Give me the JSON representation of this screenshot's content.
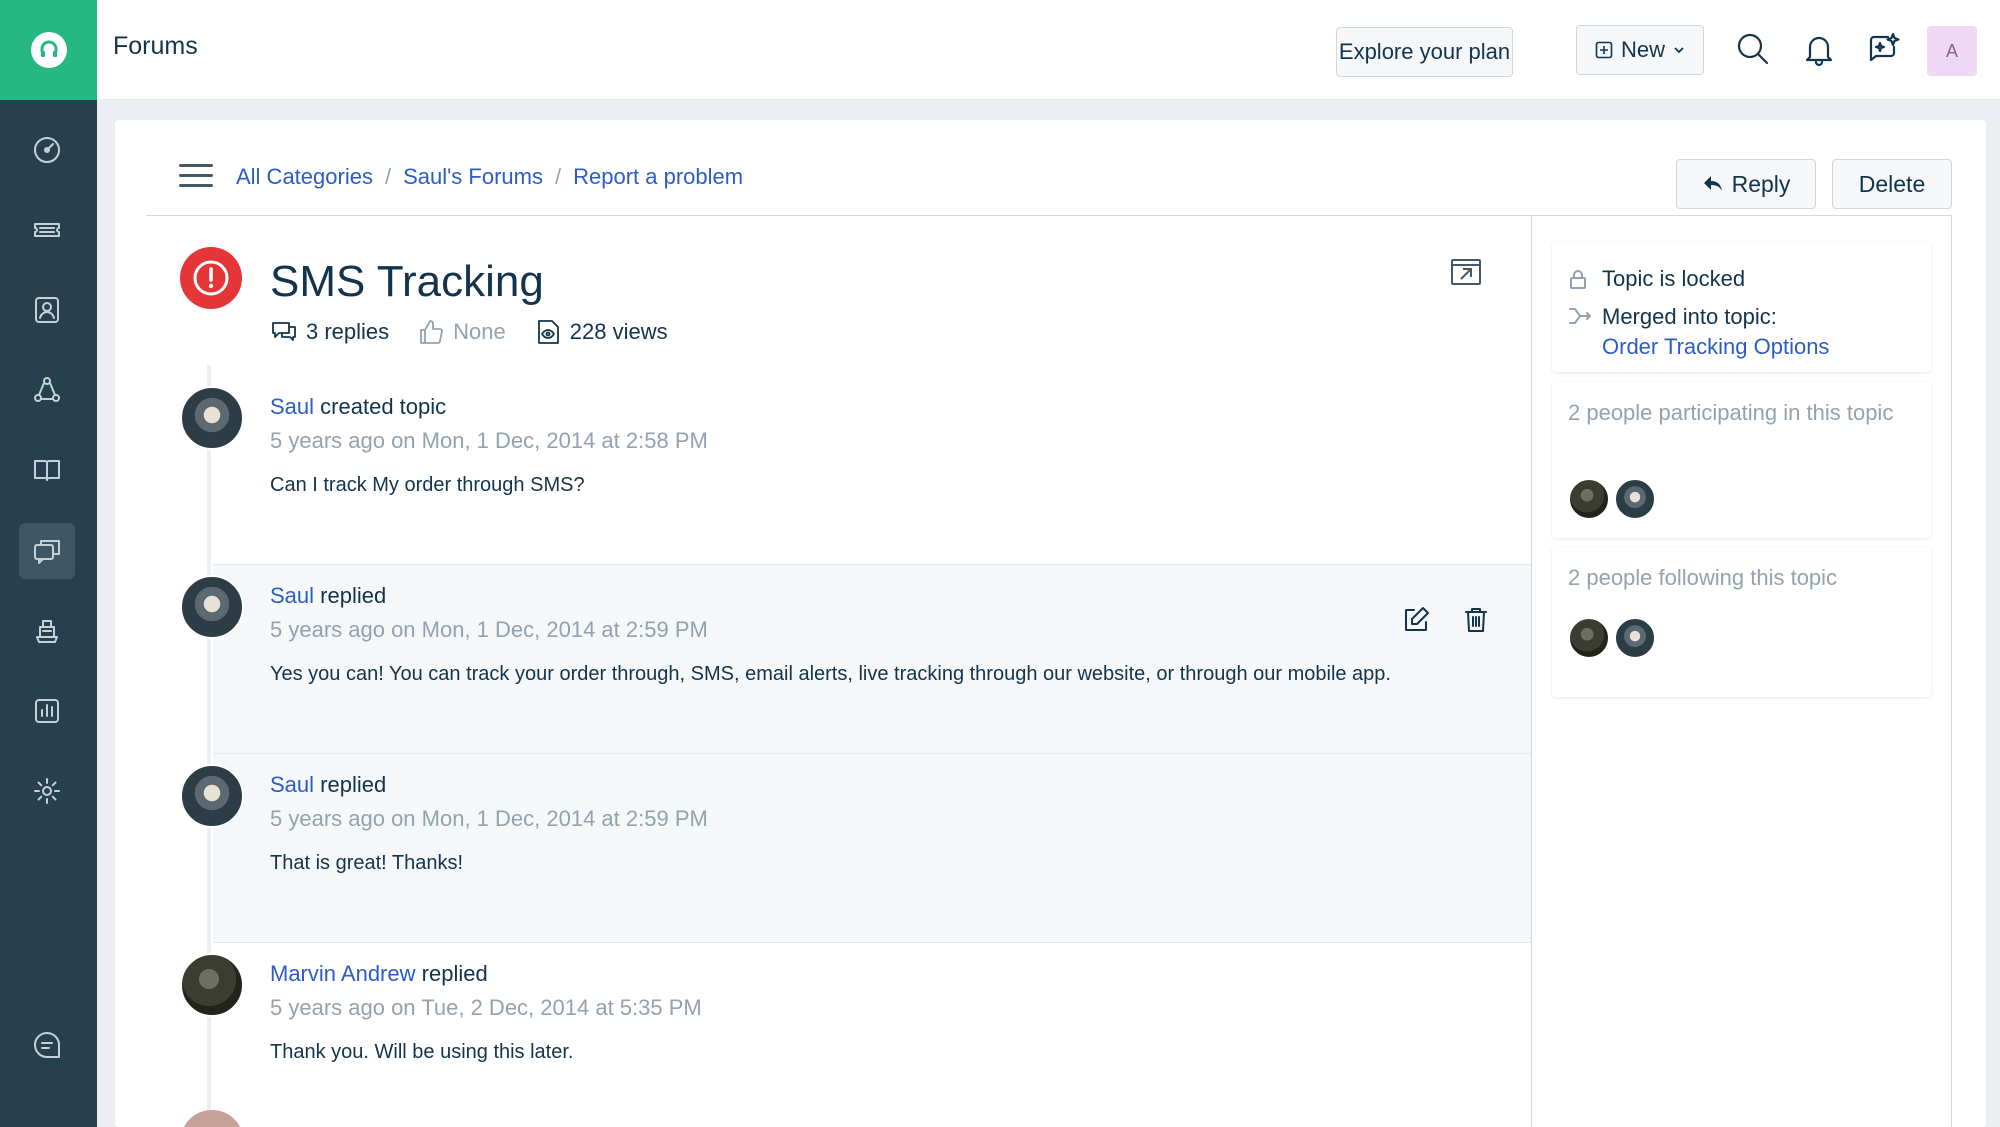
{
  "header": {
    "title": "Forums",
    "explore_label": "Explore your plan",
    "new_label": "New",
    "avatar_initial": "A"
  },
  "nav": {
    "icons": [
      "dashboard-icon",
      "tickets-icon",
      "contacts-icon",
      "groups-icon",
      "solutions-icon",
      "forums-icon",
      "ship-icon",
      "reports-icon",
      "settings-icon",
      "chat-icon"
    ],
    "active": "forums-icon"
  },
  "breadcrumb": {
    "items": [
      "All Categories",
      "Saul's Forums",
      "Report a problem"
    ],
    "separator": "/"
  },
  "actions": {
    "reply_label": "Reply",
    "delete_label": "Delete"
  },
  "topic": {
    "title": "SMS Tracking",
    "replies": "3 replies",
    "votes": "None",
    "views": "228 views"
  },
  "posts": [
    {
      "author": "Saul",
      "action": "created topic",
      "time": "5 years ago on Mon, 1 Dec, 2014 at 2:58 PM",
      "body": "Can I track My order through SMS?"
    },
    {
      "author": "Saul",
      "action": "replied",
      "time": "5 years ago on Mon, 1 Dec, 2014 at 2:59 PM",
      "body": "Yes you can! You can track your order through, SMS, email alerts, live tracking through our website, or through our mobile app."
    },
    {
      "author": "Saul",
      "action": "replied",
      "time": "5 years ago on Mon, 1 Dec, 2014 at 2:59 PM",
      "body": "That is great! Thanks!"
    },
    {
      "author": "Marvin Andrew",
      "action": "replied",
      "time": "5 years ago on Tue, 2 Dec, 2014 at 5:35 PM",
      "body": "Thank you. Will be using this later."
    }
  ],
  "sidebar": {
    "locked_text": "Topic is locked",
    "merged_text": "Merged into topic:",
    "merged_link": "Order Tracking Options",
    "participating_text": "2 people participating in this topic",
    "following_text": "2 people following this topic"
  },
  "colors": {
    "brand_green": "#25b882",
    "rail_bg": "#26404f",
    "link_blue": "#2c5cc5",
    "alert_red": "#e43538"
  }
}
